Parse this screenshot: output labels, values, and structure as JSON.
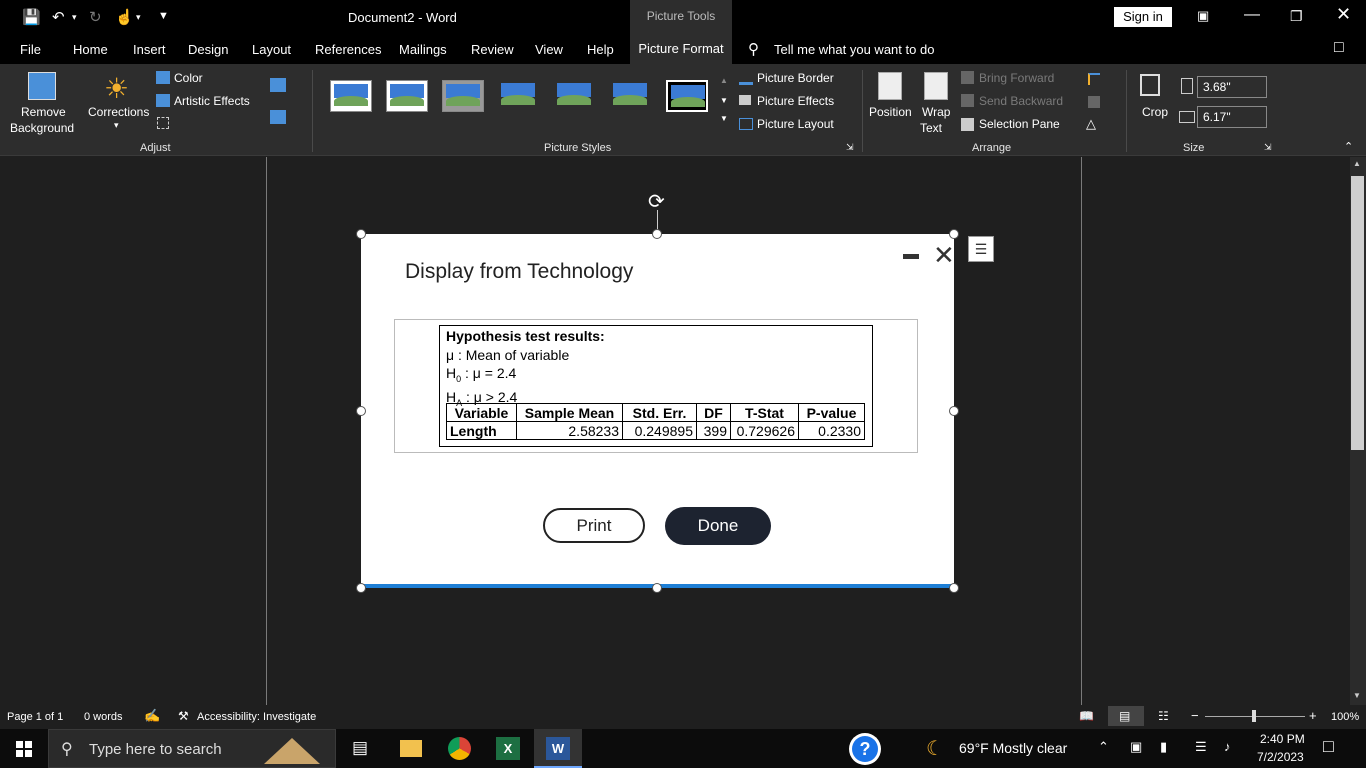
{
  "titlebar": {
    "document_title": "Document2  -  Word",
    "context_label": "Picture Tools",
    "signin_label": "Sign in"
  },
  "menu": {
    "tabs": [
      "File",
      "Home",
      "Insert",
      "Design",
      "Layout",
      "References",
      "Mailings",
      "Review",
      "View",
      "Help",
      "Picture Format"
    ],
    "tell_me": "Tell me what you want to do"
  },
  "ribbon": {
    "adjust": {
      "remove_background": [
        "Remove",
        "Background"
      ],
      "corrections": "Corrections",
      "color": "Color",
      "artistic_effects": "Artistic Effects",
      "label": "Adjust"
    },
    "picture_styles": {
      "border": "Picture Border",
      "effects": "Picture Effects",
      "layout": "Picture Layout",
      "label": "Picture Styles"
    },
    "arrange": {
      "position": "Position",
      "wrap_text": [
        "Wrap",
        "Text"
      ],
      "bring_forward": "Bring Forward",
      "send_backward": "Send Backward",
      "selection_pane": "Selection Pane",
      "label": "Arrange"
    },
    "size": {
      "crop": "Crop",
      "height": "3.68\"",
      "width": "6.17\"",
      "label": "Size"
    }
  },
  "dialog": {
    "title": "Display from Technology",
    "results": {
      "heading": "Hypothesis test results:",
      "mu_line": "μ : Mean of variable",
      "h0_prefix": "H",
      "h0_sub": "0",
      "h0_rest": " : μ = 2.4",
      "ha_prefix": "H",
      "ha_sub": "A",
      "ha_rest": " : μ > 2.4",
      "columns": [
        "Variable",
        "Sample Mean",
        "Std. Err.",
        "DF",
        "T-Stat",
        "P-value"
      ],
      "row": [
        "Length",
        "2.58233",
        "0.249895",
        "399",
        "0.729626",
        "0.2330"
      ]
    },
    "print_label": "Print",
    "done_label": "Done"
  },
  "status": {
    "page": "Page 1 of 1",
    "words": "0 words",
    "accessibility": "Accessibility: Investigate",
    "zoom": "100%"
  },
  "taskbar": {
    "search_placeholder": "Type here to search",
    "weather": "69°F  Mostly clear",
    "time": "2:40 PM",
    "date": "7/2/2023"
  }
}
